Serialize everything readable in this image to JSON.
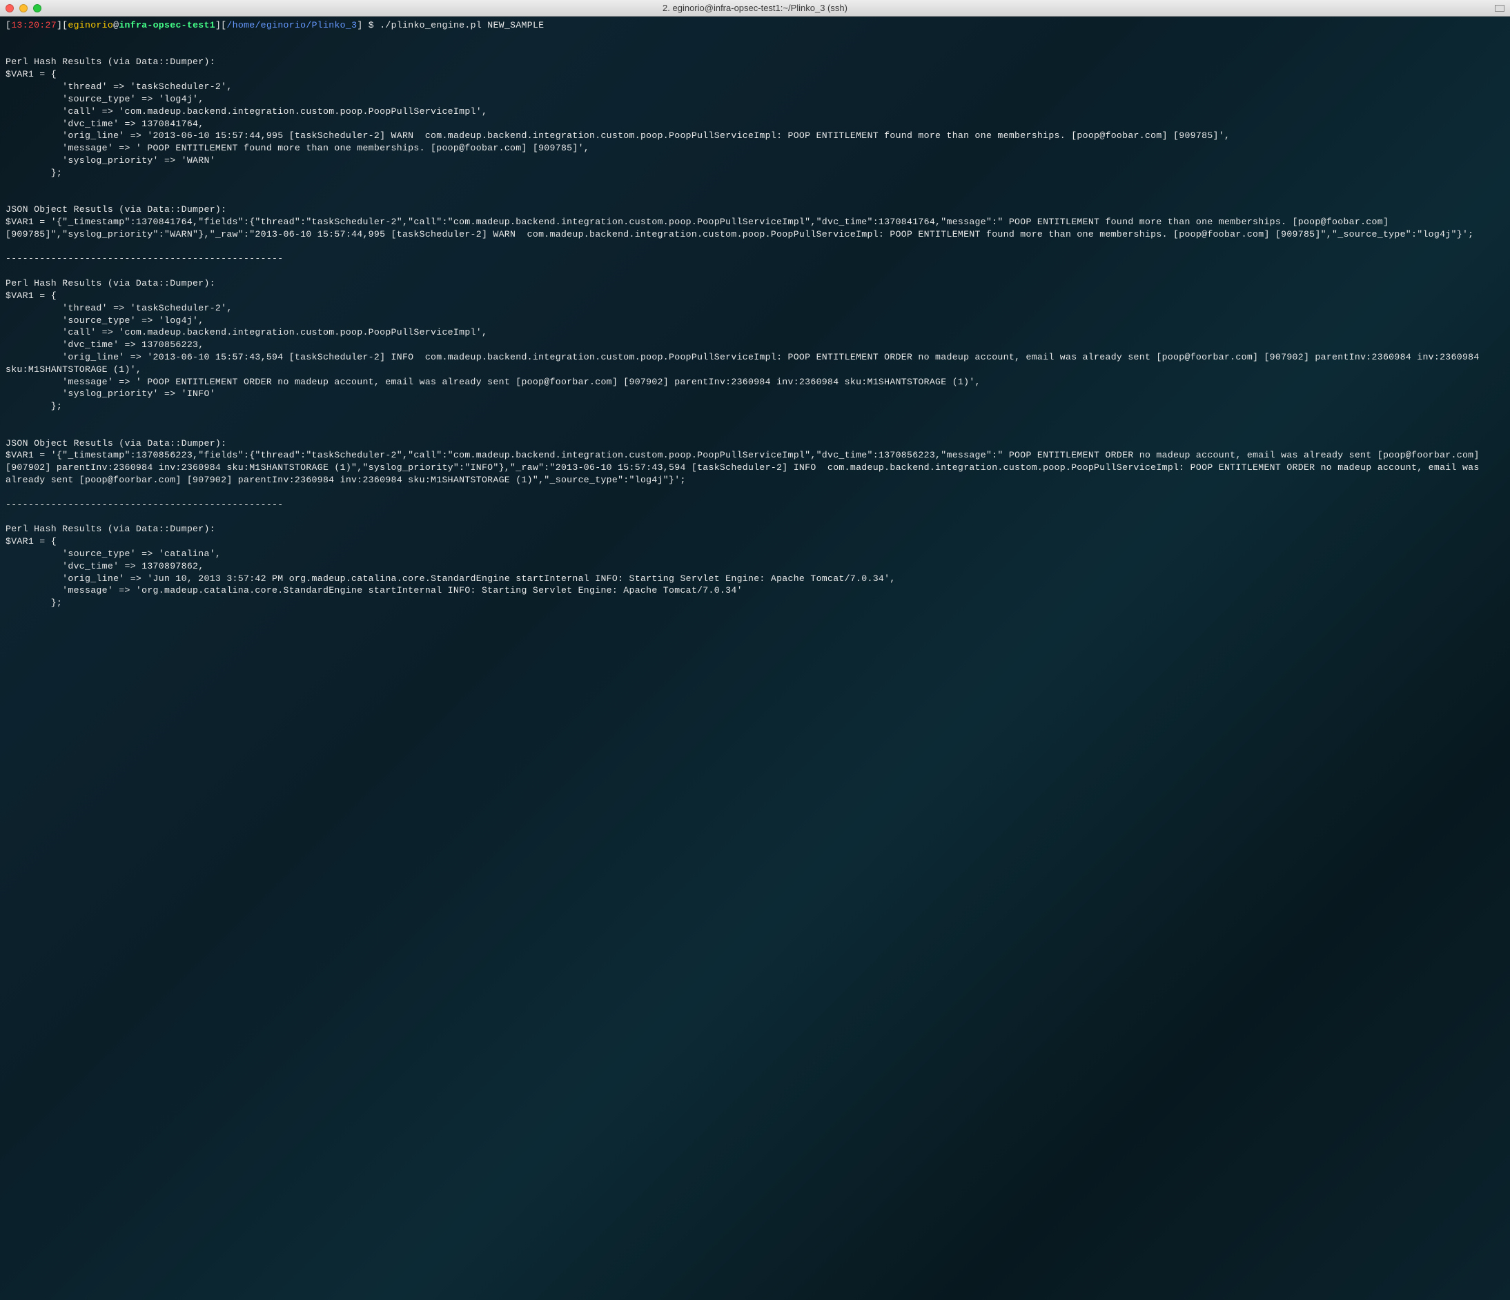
{
  "window": {
    "title": "2. eginorio@infra-opsec-test1:~/Plinko_3 (ssh)"
  },
  "prompt": {
    "time": "13:20:27",
    "user": "eginorio",
    "host": "infra-opsec-test1",
    "path": "/home/eginorio/Plinko_3",
    "command": "./plinko_engine.pl NEW_SAMPLE"
  },
  "output": {
    "block1_header": "Perl Hash Results (via Data::Dumper):",
    "block1_body": "$VAR1 = {\n          'thread' => 'taskScheduler-2',\n          'source_type' => 'log4j',\n          'call' => 'com.madeup.backend.integration.custom.poop.PoopPullServiceImpl',\n          'dvc_time' => 1370841764,\n          'orig_line' => '2013-06-10 15:57:44,995 [taskScheduler-2] WARN  com.madeup.backend.integration.custom.poop.PoopPullServiceImpl: POOP ENTITLEMENT found more than one memberships. [poop@foobar.com] [909785]',\n          'message' => ' POOP ENTITLEMENT found more than one memberships. [poop@foobar.com] [909785]',\n          'syslog_priority' => 'WARN'\n        };",
    "block2_header": "JSON Object Resutls (via Data::Dumper):",
    "block2_body": "$VAR1 = '{\"_timestamp\":1370841764,\"fields\":{\"thread\":\"taskScheduler-2\",\"call\":\"com.madeup.backend.integration.custom.poop.PoopPullServiceImpl\",\"dvc_time\":1370841764,\"message\":\" POOP ENTITLEMENT found more than one memberships. [poop@foobar.com] [909785]\",\"syslog_priority\":\"WARN\"},\"_raw\":\"2013-06-10 15:57:44,995 [taskScheduler-2] WARN  com.madeup.backend.integration.custom.poop.PoopPullServiceImpl: POOP ENTITLEMENT found more than one memberships. [poop@foobar.com] [909785]\",\"_source_type\":\"log4j\"}';",
    "separator": "-------------------------------------------------",
    "block3_header": "Perl Hash Results (via Data::Dumper):",
    "block3_body": "$VAR1 = {\n          'thread' => 'taskScheduler-2',\n          'source_type' => 'log4j',\n          'call' => 'com.madeup.backend.integration.custom.poop.PoopPullServiceImpl',\n          'dvc_time' => 1370856223,\n          'orig_line' => '2013-06-10 15:57:43,594 [taskScheduler-2] INFO  com.madeup.backend.integration.custom.poop.PoopPullServiceImpl: POOP ENTITLEMENT ORDER no madeup account, email was already sent [poop@foorbar.com] [907902] parentInv:2360984 inv:2360984 sku:M1SHANTSTORAGE (1)',\n          'message' => ' POOP ENTITLEMENT ORDER no madeup account, email was already sent [poop@foorbar.com] [907902] parentInv:2360984 inv:2360984 sku:M1SHANTSTORAGE (1)',\n          'syslog_priority' => 'INFO'\n        };",
    "block4_header": "JSON Object Resutls (via Data::Dumper):",
    "block4_body": "$VAR1 = '{\"_timestamp\":1370856223,\"fields\":{\"thread\":\"taskScheduler-2\",\"call\":\"com.madeup.backend.integration.custom.poop.PoopPullServiceImpl\",\"dvc_time\":1370856223,\"message\":\" POOP ENTITLEMENT ORDER no madeup account, email was already sent [poop@foorbar.com] [907902] parentInv:2360984 inv:2360984 sku:M1SHANTSTORAGE (1)\",\"syslog_priority\":\"INFO\"},\"_raw\":\"2013-06-10 15:57:43,594 [taskScheduler-2] INFO  com.madeup.backend.integration.custom.poop.PoopPullServiceImpl: POOP ENTITLEMENT ORDER no madeup account, email was already sent [poop@foorbar.com] [907902] parentInv:2360984 inv:2360984 sku:M1SHANTSTORAGE (1)\",\"_source_type\":\"log4j\"}';",
    "block5_header": "Perl Hash Results (via Data::Dumper):",
    "block5_body": "$VAR1 = {\n          'source_type' => 'catalina',\n          'dvc_time' => 1370897862,\n          'orig_line' => 'Jun 10, 2013 3:57:42 PM org.madeup.catalina.core.StandardEngine startInternal INFO: Starting Servlet Engine: Apache Tomcat/7.0.34',\n          'message' => 'org.madeup.catalina.core.StandardEngine startInternal INFO: Starting Servlet Engine: Apache Tomcat/7.0.34'\n        };"
  }
}
